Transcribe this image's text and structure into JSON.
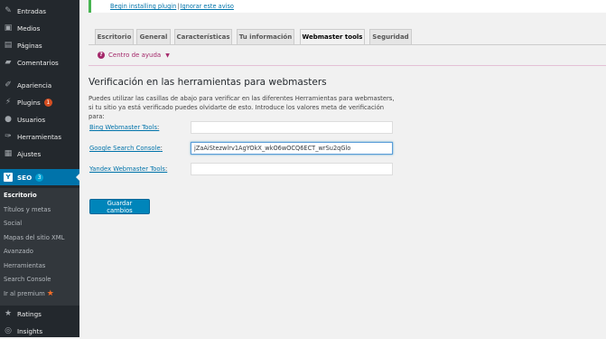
{
  "notice": {
    "link_install": "Begin installing plugin",
    "separator": "|",
    "link_ignore": "Ignorar este aviso"
  },
  "sidebar": {
    "items": [
      {
        "label": "Entradas",
        "icon": "pin-icon"
      },
      {
        "label": "Medios",
        "icon": "media-icon"
      },
      {
        "label": "Páginas",
        "icon": "pages-icon"
      },
      {
        "label": "Comentarios",
        "icon": "comment-icon"
      },
      {
        "label": "Apariencia",
        "icon": "brush-icon"
      },
      {
        "label": "Plugins",
        "icon": "plugin-icon",
        "badge": "1"
      },
      {
        "label": "Usuarios",
        "icon": "users-icon"
      },
      {
        "label": "Herramientas",
        "icon": "wrench-icon"
      },
      {
        "label": "Ajustes",
        "icon": "settings-icon"
      },
      {
        "label": "SEO",
        "icon": "yoast-icon",
        "badge": "3"
      }
    ],
    "submenu": [
      "Escritorio",
      "Títulos y metas",
      "Social",
      "Mapas del sitio XML",
      "Avanzado",
      "Herramientas",
      "Search Console",
      "Ir al premium"
    ],
    "bottom_items": [
      {
        "label": "Ratings",
        "icon": "star-icon"
      },
      {
        "label": "Insights",
        "icon": "insights-icon"
      }
    ],
    "colors": {
      "bg": "#23282d",
      "active": "#0073aa",
      "plugin_badge": "#d54e21",
      "seo_badge": "#00a0d2",
      "premium_star": "#f56e28"
    }
  },
  "tabs": [
    {
      "label": "Escritorio"
    },
    {
      "label": "General"
    },
    {
      "label": "Características"
    },
    {
      "label": "Tu información"
    },
    {
      "label": "Webmaster tools",
      "active": true
    },
    {
      "label": "Seguridad"
    }
  ],
  "help": {
    "label": "Centro de ayuda"
  },
  "main": {
    "heading": "Verificación en las herramientas para webmasters",
    "description": "Puedes utilizar las casillas de abajo para verificar en las diferentes Herramientas para webmasters, si tu sitio ya está verificado puedes olvidarte de esto. Introduce los valores meta de verificación para:",
    "fields": [
      {
        "label": "Bing Webmaster Tools",
        "suffix": ":",
        "value": ""
      },
      {
        "label": "Google Search Console",
        "suffix": ":",
        "value": "jZaAiStezwlrv1AgYOkX_wkO6wOCQ6ECT_wrSu2qGlo"
      },
      {
        "label": "Yandex Webmaster Tools",
        "suffix": ":",
        "value": ""
      }
    ],
    "save_label": "Guardar cambios"
  }
}
